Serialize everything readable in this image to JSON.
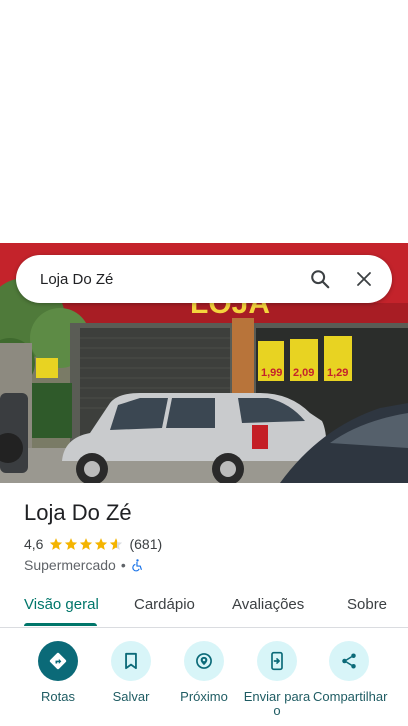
{
  "search": {
    "query": "Loja Do Zé"
  },
  "place": {
    "name": "Loja Do Zé",
    "rating": "4,6",
    "rating_value": 4.6,
    "review_count": "(681)",
    "category": "Supermercado",
    "separator": "•"
  },
  "photo": {
    "sign_text": "LOJA",
    "price_tags": [
      "1,99",
      "2,09",
      "1,29"
    ]
  },
  "tabs": [
    {
      "label": "Visão geral",
      "active": true
    },
    {
      "label": "Cardápio",
      "active": false
    },
    {
      "label": "Avaliações",
      "active": false
    },
    {
      "label": "Sobre",
      "active": false
    }
  ],
  "actions": [
    {
      "label": "Rotas",
      "icon": "directions-icon"
    },
    {
      "label": "Salvar",
      "icon": "bookmark-icon"
    },
    {
      "label": "Próximo",
      "icon": "nearby-icon"
    },
    {
      "label": "Enviar para o",
      "icon": "send-to-phone-icon"
    },
    {
      "label": "Compartilhar",
      "icon": "share-icon"
    }
  ],
  "colors": {
    "accent": "#00766a",
    "action_primary": "#0b6a78",
    "action_bg": "#d8f5f8",
    "star": "#f4b400"
  }
}
